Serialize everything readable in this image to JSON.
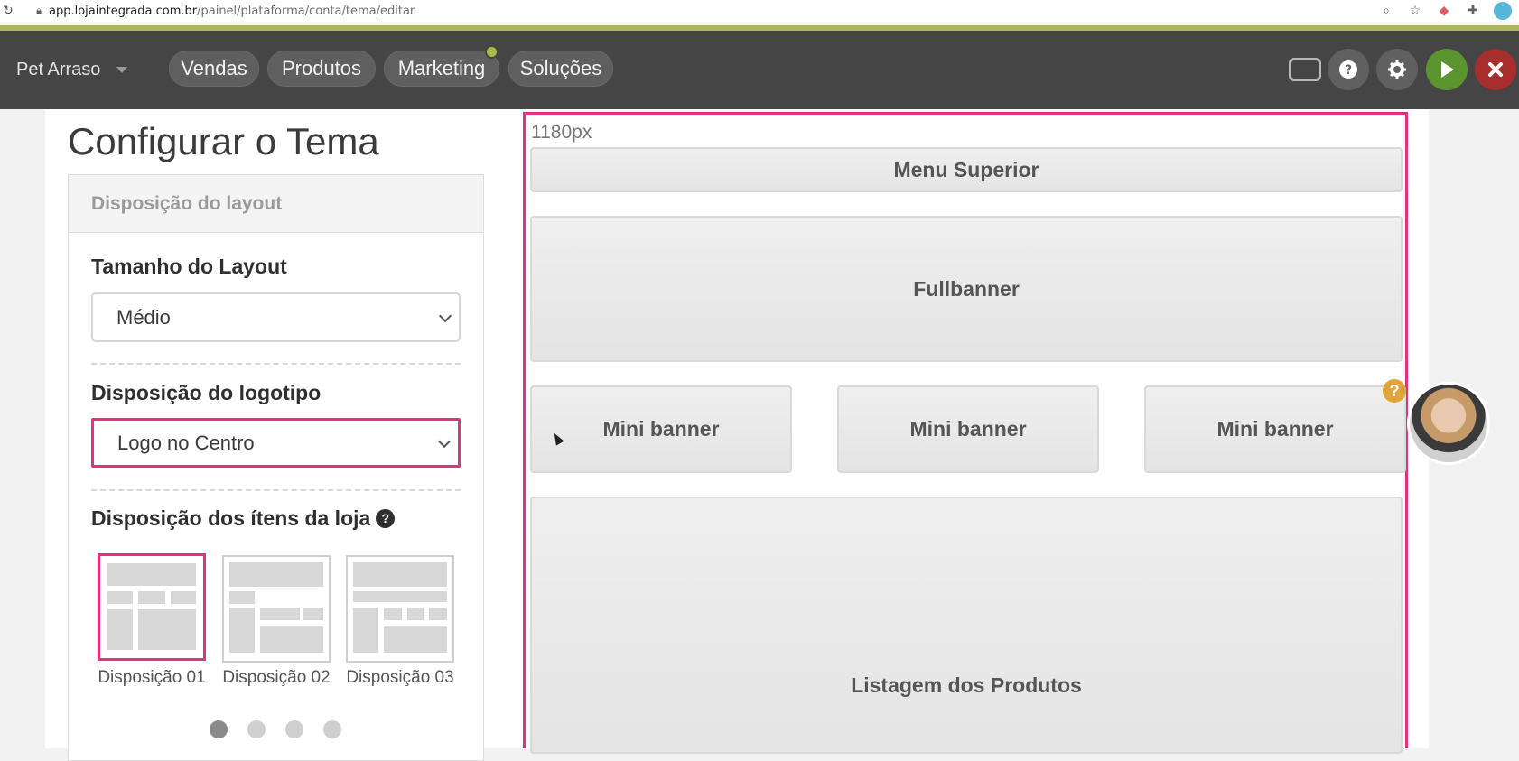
{
  "browser": {
    "url_host": "app.lojaintegrada.com.br",
    "url_path": "/painel/plataforma/conta/tema/editar",
    "icons": [
      "reload-icon",
      "lock-icon",
      "zoom-icon",
      "star-icon",
      "extension-icon",
      "puzzle-icon",
      "profile-icon"
    ]
  },
  "nav": {
    "store_name": "Pet Arraso",
    "items": [
      "Vendas",
      "Produtos",
      "Marketing",
      "Soluções"
    ],
    "colors": {
      "bar": "#454545",
      "play": "#5b952f",
      "close": "#a82e2e",
      "accent": "#aeb65d"
    }
  },
  "page": {
    "title": "Configurar o Tema",
    "panel_title": "Disposição do layout",
    "layout_size_label": "Tamanho do Layout",
    "layout_size_value": "Médio",
    "logo_label": "Disposição do logotipo",
    "logo_value": "Logo no Centro",
    "items_label": "Disposição dos ítens da loja",
    "dispositions": [
      "Disposição 01",
      "Disposição 02",
      "Disposição 03"
    ],
    "selected_disposition": "Disposição 01"
  },
  "preview": {
    "width_label": "1180px",
    "menu": "Menu Superior",
    "fullbanner": "Fullbanner",
    "mini_banners": [
      "Mini banner",
      "Mini banner",
      "Mini banner"
    ],
    "products": "Listagem dos Produtos",
    "highlight_color": "#e2337f"
  },
  "help_badge": "?"
}
